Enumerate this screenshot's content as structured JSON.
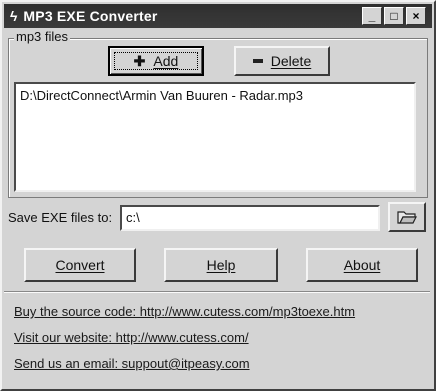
{
  "window": {
    "title": "MP3 EXE Converter",
    "icons": {
      "app": "lightning-icon",
      "minimize": "minimize-icon",
      "maximize": "maximize-icon",
      "close": "close-icon"
    }
  },
  "files_group": {
    "label": "mp3 files",
    "add_label": "Add",
    "add_icon": "plus-icon",
    "delete_label": "Delete",
    "delete_icon": "minus-icon",
    "items": [
      "D:\\DirectConnect\\Armin Van Buuren - Radar.mp3"
    ]
  },
  "save": {
    "label": "Save EXE files to:",
    "value": "c:\\",
    "browse_icon": "open-folder-icon"
  },
  "actions": {
    "convert_label": "Convert",
    "help_label": "Help",
    "about_label": "About"
  },
  "links": {
    "source": "Buy the source code: http://www.cutess.com/mp3toexe.htm",
    "website": "Visit our website: http://www.cutess.com/",
    "email": "Send us an email: suppout@itpeasy.com"
  }
}
